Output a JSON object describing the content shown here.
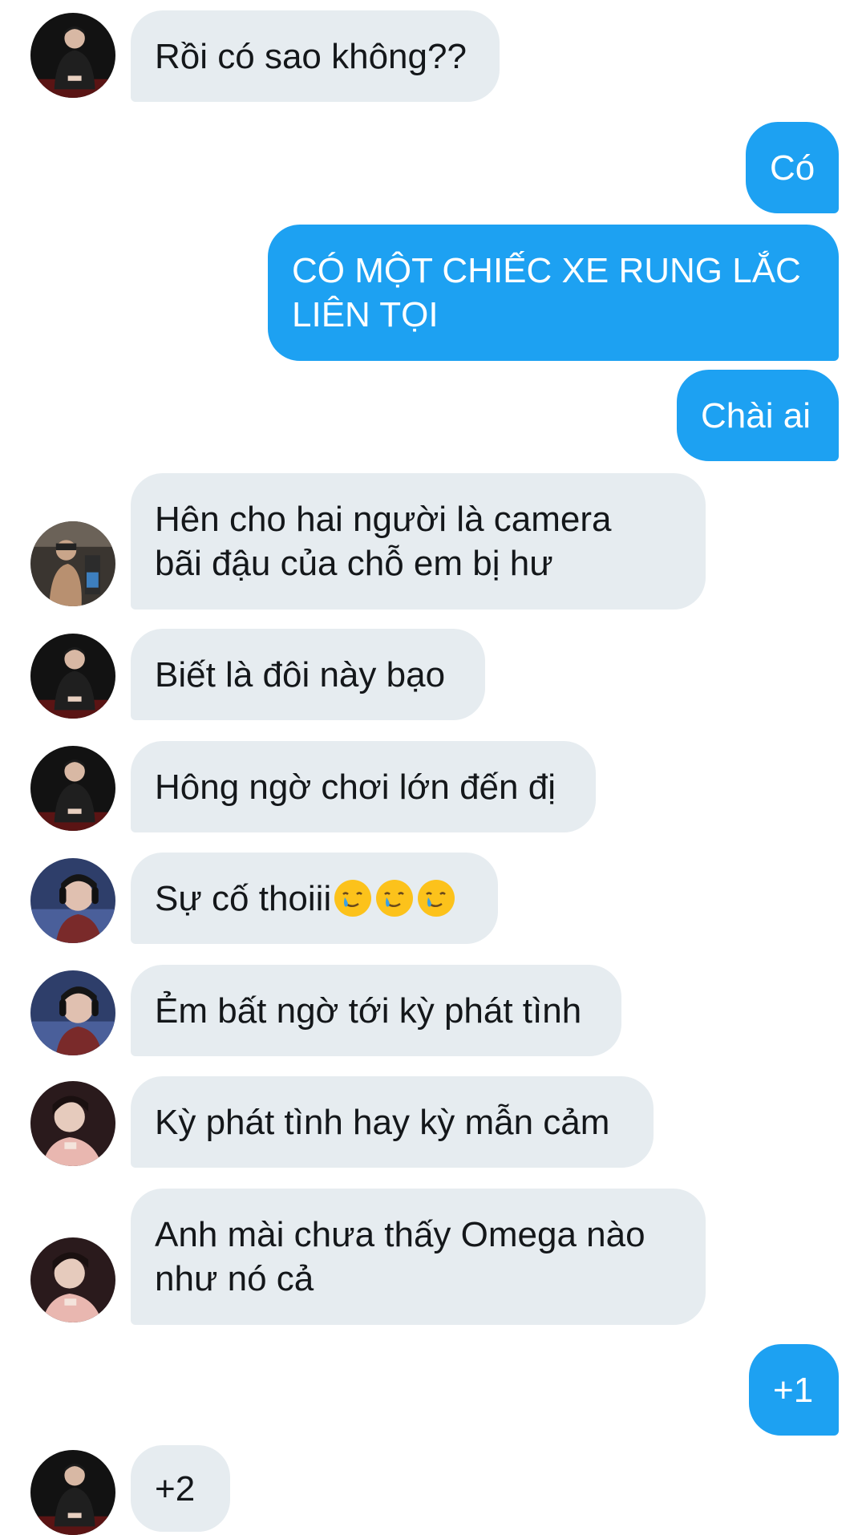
{
  "chat": {
    "messages": [
      {
        "id": "m1",
        "direction": "incoming",
        "avatar": "avatar-a",
        "text": "Rồi có sao không??"
      },
      {
        "id": "m2",
        "direction": "outgoing",
        "text": "Có"
      },
      {
        "id": "m3",
        "direction": "outgoing",
        "text": "CÓ MỘT CHIẾC XE RUNG LẮC\nLIÊN TỌI"
      },
      {
        "id": "m4",
        "direction": "outgoing",
        "text": "Chài ai"
      },
      {
        "id": "m5",
        "direction": "incoming",
        "avatar": "avatar-b",
        "text": "Hên cho hai người là camera\nbãi đậu của chỗ em bị hư"
      },
      {
        "id": "m6",
        "direction": "incoming",
        "avatar": "avatar-a",
        "text": "Biết là đôi này bạo"
      },
      {
        "id": "m7",
        "direction": "incoming",
        "avatar": "avatar-a",
        "text": "Hông ngờ chơi lớn đến đị"
      },
      {
        "id": "m8",
        "direction": "incoming",
        "avatar": "avatar-c",
        "text": "Sự cố thoiii",
        "emoji": [
          "crying-smile-emoji",
          "crying-smile-emoji",
          "crying-smile-emoji"
        ]
      },
      {
        "id": "m9",
        "direction": "incoming",
        "avatar": "avatar-c",
        "text": "Ẻm bất ngờ tới kỳ phát tình"
      },
      {
        "id": "m10",
        "direction": "incoming",
        "avatar": "avatar-d",
        "text": "Kỳ phát tình hay kỳ mẫn cảm"
      },
      {
        "id": "m11",
        "direction": "incoming",
        "avatar": "avatar-d",
        "text": "Anh mài chưa thấy Omega nào\nnhư nó cả"
      },
      {
        "id": "m12",
        "direction": "outgoing",
        "text": "+1"
      },
      {
        "id": "m13",
        "direction": "incoming",
        "avatar": "avatar-a",
        "text": "+2"
      }
    ]
  },
  "colors": {
    "incoming_bubble": "#e6ecf0",
    "outgoing_bubble": "#1da1f2",
    "incoming_text": "#14171a",
    "outgoing_text": "#ffffff"
  }
}
